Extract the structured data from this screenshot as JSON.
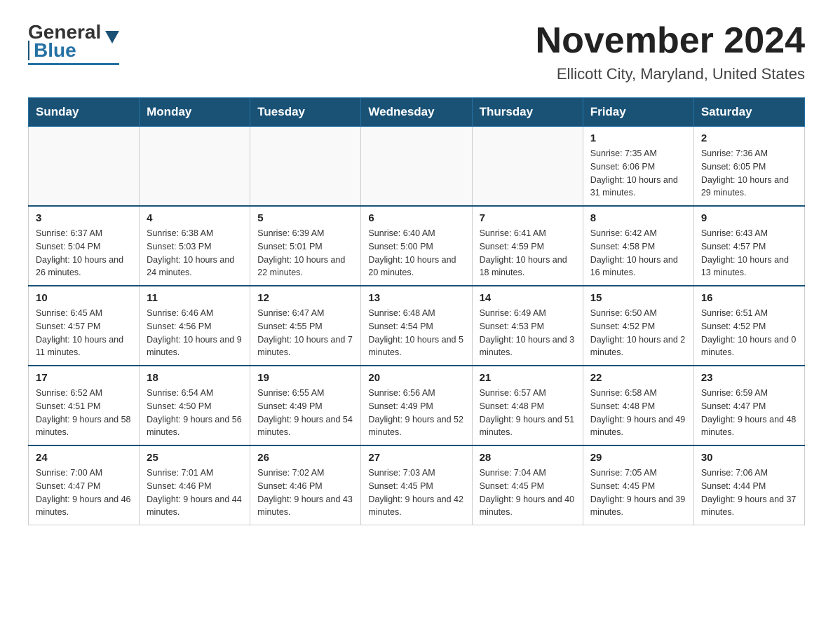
{
  "header": {
    "logo_general": "General",
    "logo_blue": "Blue",
    "month_title": "November 2024",
    "location": "Ellicott City, Maryland, United States"
  },
  "days_of_week": [
    "Sunday",
    "Monday",
    "Tuesday",
    "Wednesday",
    "Thursday",
    "Friday",
    "Saturday"
  ],
  "weeks": [
    [
      {
        "day": "",
        "sunrise": "",
        "sunset": "",
        "daylight": ""
      },
      {
        "day": "",
        "sunrise": "",
        "sunset": "",
        "daylight": ""
      },
      {
        "day": "",
        "sunrise": "",
        "sunset": "",
        "daylight": ""
      },
      {
        "day": "",
        "sunrise": "",
        "sunset": "",
        "daylight": ""
      },
      {
        "day": "",
        "sunrise": "",
        "sunset": "",
        "daylight": ""
      },
      {
        "day": "1",
        "sunrise": "Sunrise: 7:35 AM",
        "sunset": "Sunset: 6:06 PM",
        "daylight": "Daylight: 10 hours and 31 minutes."
      },
      {
        "day": "2",
        "sunrise": "Sunrise: 7:36 AM",
        "sunset": "Sunset: 6:05 PM",
        "daylight": "Daylight: 10 hours and 29 minutes."
      }
    ],
    [
      {
        "day": "3",
        "sunrise": "Sunrise: 6:37 AM",
        "sunset": "Sunset: 5:04 PM",
        "daylight": "Daylight: 10 hours and 26 minutes."
      },
      {
        "day": "4",
        "sunrise": "Sunrise: 6:38 AM",
        "sunset": "Sunset: 5:03 PM",
        "daylight": "Daylight: 10 hours and 24 minutes."
      },
      {
        "day": "5",
        "sunrise": "Sunrise: 6:39 AM",
        "sunset": "Sunset: 5:01 PM",
        "daylight": "Daylight: 10 hours and 22 minutes."
      },
      {
        "day": "6",
        "sunrise": "Sunrise: 6:40 AM",
        "sunset": "Sunset: 5:00 PM",
        "daylight": "Daylight: 10 hours and 20 minutes."
      },
      {
        "day": "7",
        "sunrise": "Sunrise: 6:41 AM",
        "sunset": "Sunset: 4:59 PM",
        "daylight": "Daylight: 10 hours and 18 minutes."
      },
      {
        "day": "8",
        "sunrise": "Sunrise: 6:42 AM",
        "sunset": "Sunset: 4:58 PM",
        "daylight": "Daylight: 10 hours and 16 minutes."
      },
      {
        "day": "9",
        "sunrise": "Sunrise: 6:43 AM",
        "sunset": "Sunset: 4:57 PM",
        "daylight": "Daylight: 10 hours and 13 minutes."
      }
    ],
    [
      {
        "day": "10",
        "sunrise": "Sunrise: 6:45 AM",
        "sunset": "Sunset: 4:57 PM",
        "daylight": "Daylight: 10 hours and 11 minutes."
      },
      {
        "day": "11",
        "sunrise": "Sunrise: 6:46 AM",
        "sunset": "Sunset: 4:56 PM",
        "daylight": "Daylight: 10 hours and 9 minutes."
      },
      {
        "day": "12",
        "sunrise": "Sunrise: 6:47 AM",
        "sunset": "Sunset: 4:55 PM",
        "daylight": "Daylight: 10 hours and 7 minutes."
      },
      {
        "day": "13",
        "sunrise": "Sunrise: 6:48 AM",
        "sunset": "Sunset: 4:54 PM",
        "daylight": "Daylight: 10 hours and 5 minutes."
      },
      {
        "day": "14",
        "sunrise": "Sunrise: 6:49 AM",
        "sunset": "Sunset: 4:53 PM",
        "daylight": "Daylight: 10 hours and 3 minutes."
      },
      {
        "day": "15",
        "sunrise": "Sunrise: 6:50 AM",
        "sunset": "Sunset: 4:52 PM",
        "daylight": "Daylight: 10 hours and 2 minutes."
      },
      {
        "day": "16",
        "sunrise": "Sunrise: 6:51 AM",
        "sunset": "Sunset: 4:52 PM",
        "daylight": "Daylight: 10 hours and 0 minutes."
      }
    ],
    [
      {
        "day": "17",
        "sunrise": "Sunrise: 6:52 AM",
        "sunset": "Sunset: 4:51 PM",
        "daylight": "Daylight: 9 hours and 58 minutes."
      },
      {
        "day": "18",
        "sunrise": "Sunrise: 6:54 AM",
        "sunset": "Sunset: 4:50 PM",
        "daylight": "Daylight: 9 hours and 56 minutes."
      },
      {
        "day": "19",
        "sunrise": "Sunrise: 6:55 AM",
        "sunset": "Sunset: 4:49 PM",
        "daylight": "Daylight: 9 hours and 54 minutes."
      },
      {
        "day": "20",
        "sunrise": "Sunrise: 6:56 AM",
        "sunset": "Sunset: 4:49 PM",
        "daylight": "Daylight: 9 hours and 52 minutes."
      },
      {
        "day": "21",
        "sunrise": "Sunrise: 6:57 AM",
        "sunset": "Sunset: 4:48 PM",
        "daylight": "Daylight: 9 hours and 51 minutes."
      },
      {
        "day": "22",
        "sunrise": "Sunrise: 6:58 AM",
        "sunset": "Sunset: 4:48 PM",
        "daylight": "Daylight: 9 hours and 49 minutes."
      },
      {
        "day": "23",
        "sunrise": "Sunrise: 6:59 AM",
        "sunset": "Sunset: 4:47 PM",
        "daylight": "Daylight: 9 hours and 48 minutes."
      }
    ],
    [
      {
        "day": "24",
        "sunrise": "Sunrise: 7:00 AM",
        "sunset": "Sunset: 4:47 PM",
        "daylight": "Daylight: 9 hours and 46 minutes."
      },
      {
        "day": "25",
        "sunrise": "Sunrise: 7:01 AM",
        "sunset": "Sunset: 4:46 PM",
        "daylight": "Daylight: 9 hours and 44 minutes."
      },
      {
        "day": "26",
        "sunrise": "Sunrise: 7:02 AM",
        "sunset": "Sunset: 4:46 PM",
        "daylight": "Daylight: 9 hours and 43 minutes."
      },
      {
        "day": "27",
        "sunrise": "Sunrise: 7:03 AM",
        "sunset": "Sunset: 4:45 PM",
        "daylight": "Daylight: 9 hours and 42 minutes."
      },
      {
        "day": "28",
        "sunrise": "Sunrise: 7:04 AM",
        "sunset": "Sunset: 4:45 PM",
        "daylight": "Daylight: 9 hours and 40 minutes."
      },
      {
        "day": "29",
        "sunrise": "Sunrise: 7:05 AM",
        "sunset": "Sunset: 4:45 PM",
        "daylight": "Daylight: 9 hours and 39 minutes."
      },
      {
        "day": "30",
        "sunrise": "Sunrise: 7:06 AM",
        "sunset": "Sunset: 4:44 PM",
        "daylight": "Daylight: 9 hours and 37 minutes."
      }
    ]
  ]
}
